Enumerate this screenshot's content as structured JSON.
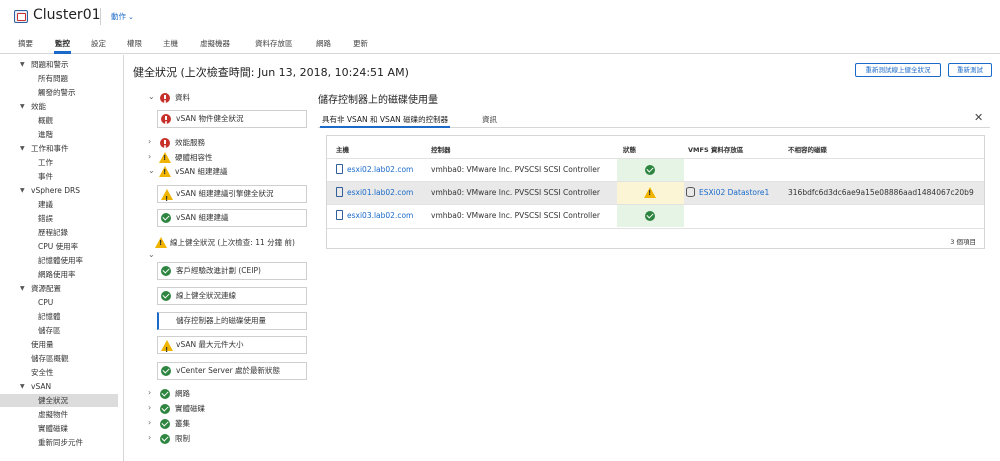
{
  "header": {
    "title": "Cluster01",
    "actions_label": "動作"
  },
  "tabs": [
    "摘要",
    "監控",
    "設定",
    "權限",
    "主機",
    "虛擬機器",
    "資料存放區",
    "網路",
    "更新"
  ],
  "nav": {
    "items": [
      {
        "label": "問題和警示",
        "level": 0,
        "expanded": true
      },
      {
        "label": "所有問題",
        "level": 1
      },
      {
        "label": "觸發的警示",
        "level": 1
      },
      {
        "label": "效能",
        "level": 0,
        "expanded": true
      },
      {
        "label": "概觀",
        "level": 1
      },
      {
        "label": "進階",
        "level": 1
      },
      {
        "label": "工作和事件",
        "level": 0,
        "expanded": true
      },
      {
        "label": "工作",
        "level": 1
      },
      {
        "label": "事件",
        "level": 1
      },
      {
        "label": "vSphere DRS",
        "level": 0,
        "expanded": true
      },
      {
        "label": "建議",
        "level": 1
      },
      {
        "label": "錯誤",
        "level": 1
      },
      {
        "label": "歷程記錄",
        "level": 1
      },
      {
        "label": "CPU 使用率",
        "level": 1
      },
      {
        "label": "記憶體使用率",
        "level": 1
      },
      {
        "label": "網路使用率",
        "level": 1
      },
      {
        "label": "資源配置",
        "level": 0,
        "expanded": true
      },
      {
        "label": "CPU",
        "level": 1
      },
      {
        "label": "記憶體",
        "level": 1
      },
      {
        "label": "儲存區",
        "level": 1
      },
      {
        "label": "使用量",
        "level": 0
      },
      {
        "label": "儲存區概觀",
        "level": 0
      },
      {
        "label": "安全性",
        "level": 0
      },
      {
        "label": "vSAN",
        "level": 0,
        "expanded": true
      },
      {
        "label": "健全狀況",
        "level": 1,
        "selected": true
      },
      {
        "label": "虛擬物件",
        "level": 1
      },
      {
        "label": "實體磁碟",
        "level": 1
      },
      {
        "label": "重新同步元件",
        "level": 1
      }
    ]
  },
  "main": {
    "title": "健全狀況 (上次檢查時間: Jun 13, 2018, 10:24:51 AM)",
    "retest_online_label": "重新測試線上健全狀況",
    "retest_label": "重新測試"
  },
  "checks": {
    "data_group": "資料",
    "data_card": "vSAN 物件健全狀況",
    "perf_service": "效能服務",
    "hw_compat": "硬體相容性",
    "build_rec": "vSAN 組建建議",
    "build_rec_engine": "vSAN 組建建議引擎健全狀況",
    "build_rec_card": "vSAN 組建建議",
    "online_health": "線上健全狀況 (上次檢查: 11 分鐘 前)",
    "ceip": "客戶經驗改進計劃 (CEIP)",
    "online_conn": "線上健全狀況連線",
    "controller_disk": "儲存控制器上的磁碟使用量",
    "max_component": "vSAN 最大元件大小",
    "vcenter": "vCenter Server 處於最新狀態",
    "network": "網路",
    "physical_disk": "實體磁碟",
    "cluster": "叢集",
    "limits": "限制"
  },
  "detail": {
    "title": "儲存控制器上的磁碟使用量",
    "tab_active": "具有非 VSAN 和 VSAN 磁碟的控制器",
    "tab_info": "資訊",
    "columns": [
      "主機",
      "控制器",
      "狀態",
      "VMFS 資料存放區",
      "不相容的磁碟"
    ],
    "rows": [
      {
        "host": "esxi02.lab02.com",
        "controller": "vmhba0: VMware Inc. PVSCSI SCSI Controller",
        "status": "ok",
        "datastore": "",
        "disk": ""
      },
      {
        "host": "esxi01.lab02.com",
        "controller": "vmhba0: VMware Inc. PVSCSI SCSI Controller",
        "status": "warning",
        "datastore": "ESXi02 Datastore1",
        "disk": "316bdfc6d3dc6ae9a15e08886aad1484067c20b9"
      },
      {
        "host": "esxi03.lab02.com",
        "controller": "vmhba0: VMware Inc. PVSCSI SCSI Controller",
        "status": "ok",
        "datastore": "",
        "disk": ""
      }
    ],
    "item_count": "3 個項目"
  },
  "colors": {
    "accent": "#1b6ac9",
    "ok": "#2e8540",
    "warning": "#f0b400",
    "error": "#c8312b"
  }
}
